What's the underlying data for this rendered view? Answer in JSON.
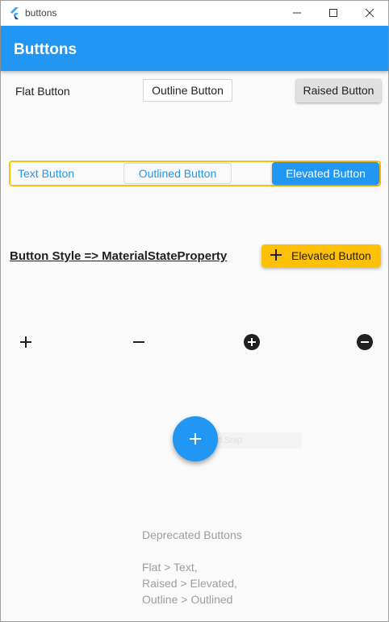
{
  "window": {
    "title": "buttons"
  },
  "appbar": {
    "title": "Butttons"
  },
  "row1": {
    "flat_label": "Flat Button",
    "outline_label": "Outline Button",
    "raised_label": "Raised Button"
  },
  "row2": {
    "text_label": "Text Button",
    "outlined_label": "Outlined Button",
    "elevated_label": "Elevated Button"
  },
  "row3": {
    "style_label": "Button Style => MaterialStateProperty",
    "elevated_label": "Elevated Button"
  },
  "icons": [
    "plus-icon",
    "minus-icon",
    "plus-circle-icon",
    "minus-circle-icon"
  ],
  "fab": {
    "icon": "plus-icon",
    "tooltip": "Ctrl Snip"
  },
  "deprecated": {
    "title": "Deprecated Buttons",
    "lines": [
      "Flat > Text,",
      "Raised > Elevated,",
      "Outline > Outlined"
    ]
  },
  "colors": {
    "primary": "#2196f3",
    "amber": "#ffc107",
    "raised_bg": "#e0e0e0",
    "background": "#fafafa"
  }
}
